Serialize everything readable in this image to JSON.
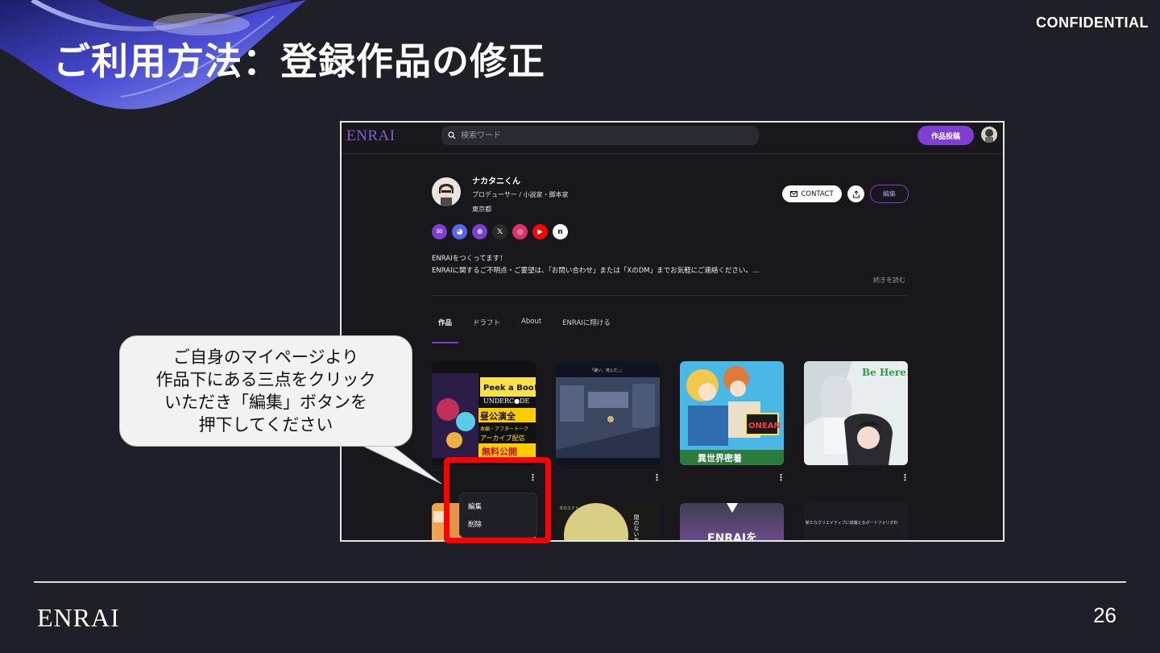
{
  "slide": {
    "title": "ご利用方法：登録作品の修正",
    "confidential": "CONFIDENTIAL",
    "footer_logo": "ENRAI",
    "page_number": "26"
  },
  "callout": {
    "lines": [
      "ご自身のマイページより",
      "作品下にある三点をクリック",
      "いただき「編集」ボタンを",
      "押下してください"
    ]
  },
  "app": {
    "logo": "ENRAI",
    "search_placeholder": "検索ワード",
    "post_button": "作品投稿"
  },
  "profile": {
    "name": "ナカタニくん",
    "role": "プロデューサー / 小説家・脚本家",
    "location": "東京都",
    "contact_label": "CONTACT",
    "edit_label": "編集",
    "socials": [
      "mail-icon",
      "discord-icon",
      "globe-icon",
      "x-icon",
      "instagram-icon",
      "youtube-icon",
      "note-icon"
    ],
    "bio_lines": [
      "ENRAIをつくってます！",
      "ENRAIに関するご不明点・ご要望は、「お問い合わせ」または「XのDM」までお気軽にご連絡ください。…"
    ],
    "read_more": "続きを読む"
  },
  "tabs": [
    "作品",
    "ドラフト",
    "About",
    "ENRAIに翔ける"
  ],
  "works": {
    "card1_text": [
      "Peek a Boo!",
      "UNDERC●DE",
      "昼公演全",
      "本編・アフタートーク",
      "アーカイブ配信",
      "無料公開"
    ],
    "card2_caption": "「嫌い、死んだ。」",
    "card3_text": [
      "ONEAN",
      "異世界密着"
    ],
    "card4_text": "Be Here!",
    "row2_card3_text": "ENRAIを",
    "row2_card4_text": "新たなクリエイティブに挑戦えるポートフォリオEI",
    "row2_card2_text": "閉のないお面",
    "row2_card2_side": "タのエイト"
  },
  "menu": {
    "edit": "編集",
    "delete": "削除"
  }
}
